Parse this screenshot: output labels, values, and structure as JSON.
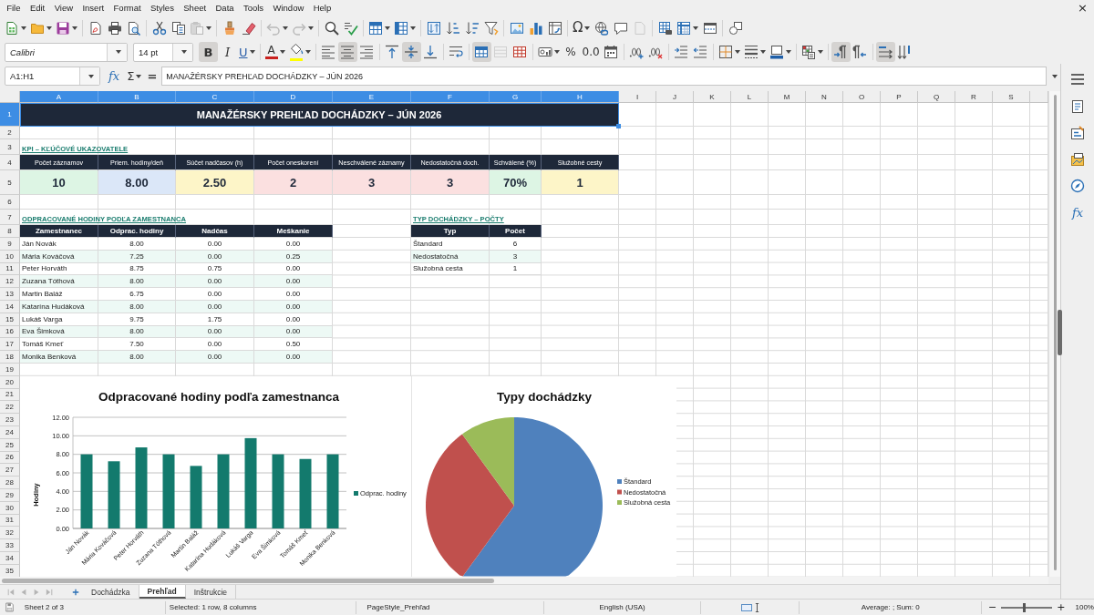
{
  "menu_bar": [
    "File",
    "Edit",
    "View",
    "Insert",
    "Format",
    "Styles",
    "Sheet",
    "Data",
    "Tools",
    "Window",
    "Help"
  ],
  "close_button": "×",
  "standard_toolbar": [
    [
      {
        "kind": "icon",
        "dropdown": true,
        "disabled": false
      },
      {
        "kind": "icon",
        "dropdown": true,
        "disabled": false
      },
      {
        "kind": "icon",
        "dropdown": true,
        "disabled": false
      }
    ],
    [
      {
        "kind": "icon",
        "dropdown": false,
        "disabled": false
      },
      {
        "kind": "icon",
        "dropdown": false,
        "disabled": false
      },
      {
        "kind": "icon",
        "dropdown": false,
        "disabled": false
      }
    ],
    [
      {
        "kind": "icon",
        "dropdown": false,
        "disabled": false
      },
      {
        "kind": "icon",
        "dropdown": false,
        "disabled": false
      },
      {
        "kind": "icon",
        "dropdown": true,
        "disabled": true
      }
    ],
    [
      {
        "kind": "icon",
        "dropdown": false,
        "disabled": false
      },
      {
        "kind": "icon",
        "dropdown": false,
        "disabled": false
      }
    ],
    [
      {
        "kind": "icon",
        "dropdown": true,
        "disabled": true
      },
      {
        "kind": "icon",
        "dropdown": true,
        "disabled": true
      }
    ],
    [
      {
        "kind": "icon",
        "dropdown": false,
        "disabled": false
      },
      {
        "kind": "icon",
        "dropdown": false,
        "disabled": false
      }
    ],
    [
      {
        "kind": "icon",
        "dropdown": true,
        "disabled": false
      },
      {
        "kind": "icon",
        "dropdown": true,
        "disabled": false
      }
    ],
    [
      {
        "kind": "icon",
        "dropdown": false,
        "disabled": false
      },
      {
        "kind": "icon",
        "dropdown": false,
        "disabled": false
      },
      {
        "kind": "icon",
        "dropdown": false,
        "disabled": false
      },
      {
        "kind": "icon",
        "dropdown": false,
        "disabled": false
      }
    ],
    [
      {
        "kind": "icon",
        "dropdown": false,
        "disabled": false
      },
      {
        "kind": "icon",
        "dropdown": false,
        "disabled": false
      },
      {
        "kind": "icon",
        "dropdown": false,
        "disabled": false
      }
    ],
    [
      {
        "kind": "glyph",
        "label": "Ω",
        "dropdown": true,
        "disabled": false
      },
      {
        "kind": "icon",
        "dropdown": false,
        "disabled": false
      },
      {
        "kind": "icon",
        "dropdown": false,
        "disabled": false
      },
      {
        "kind": "icon",
        "dropdown": false,
        "disabled": true
      }
    ],
    [
      {
        "kind": "icon",
        "dropdown": false,
        "disabled": false
      },
      {
        "kind": "icon",
        "dropdown": true,
        "disabled": false
      },
      {
        "kind": "icon",
        "dropdown": false,
        "disabled": false
      }
    ],
    [
      {
        "kind": "icon",
        "dropdown": false,
        "disabled": false
      }
    ]
  ],
  "formatting_toolbar": {
    "font_name": "Calibri",
    "font_size": "14 pt",
    "groups": [
      [
        {
          "kind": "glyph",
          "label": "B",
          "dropdown": false,
          "on": true,
          "disabled": false
        },
        {
          "kind": "glyph",
          "label": "I",
          "dropdown": false,
          "on": false,
          "disabled": false
        },
        {
          "kind": "glyph",
          "label": "U",
          "dropdown": true,
          "on": false,
          "disabled": false
        }
      ],
      [
        {
          "kind": "glyph",
          "label": "A",
          "dropdown": true,
          "on": false,
          "disabled": false,
          "color": "#c9211e"
        },
        {
          "kind": "icon",
          "dropdown": true,
          "on": false,
          "disabled": false,
          "color": "#ffff00"
        }
      ],
      [
        {
          "kind": "icon",
          "dropdown": false,
          "on": false,
          "disabled": false
        },
        {
          "kind": "icon",
          "dropdown": false,
          "on": true,
          "disabled": false
        },
        {
          "kind": "icon",
          "dropdown": false,
          "on": false,
          "disabled": false
        }
      ],
      [
        {
          "kind": "icon",
          "dropdown": false,
          "on": false,
          "disabled": false
        },
        {
          "kind": "icon",
          "dropdown": false,
          "on": true,
          "disabled": false
        },
        {
          "kind": "icon",
          "dropdown": false,
          "on": false,
          "disabled": false
        }
      ],
      [
        {
          "kind": "icon",
          "dropdown": false,
          "on": false,
          "disabled": false
        }
      ],
      [
        {
          "kind": "icon",
          "dropdown": false,
          "on": true,
          "disabled": false
        },
        {
          "kind": "icon",
          "dropdown": false,
          "on": false,
          "disabled": true
        },
        {
          "kind": "icon",
          "dropdown": false,
          "on": false,
          "disabled": false
        }
      ],
      [
        {
          "kind": "icon",
          "dropdown": true,
          "on": false,
          "disabled": false
        },
        {
          "kind": "glyph",
          "label": "%",
          "dropdown": false,
          "on": false,
          "disabled": false
        },
        {
          "kind": "glyph",
          "label": "0.0",
          "dropdown": false,
          "on": false,
          "disabled": false
        },
        {
          "kind": "icon",
          "dropdown": false,
          "on": false,
          "disabled": false
        }
      ],
      [
        {
          "kind": "icon",
          "dropdown": false,
          "on": false,
          "disabled": false
        },
        {
          "kind": "icon",
          "dropdown": false,
          "on": false,
          "disabled": false
        }
      ],
      [
        {
          "kind": "icon",
          "dropdown": false,
          "on": false,
          "disabled": false
        },
        {
          "kind": "icon",
          "dropdown": false,
          "on": false,
          "disabled": false
        }
      ],
      [
        {
          "kind": "icon",
          "dropdown": true,
          "on": false,
          "disabled": false
        },
        {
          "kind": "icon",
          "dropdown": true,
          "on": false,
          "disabled": false
        },
        {
          "kind": "icon",
          "dropdown": true,
          "on": false,
          "disabled": false
        }
      ],
      [
        {
          "kind": "icon",
          "dropdown": true,
          "on": false,
          "disabled": false
        }
      ],
      [
        {
          "kind": "icon",
          "dropdown": false,
          "on": true,
          "disabled": false
        },
        {
          "kind": "icon",
          "dropdown": false,
          "on": false,
          "disabled": false
        }
      ],
      [
        {
          "kind": "icon",
          "dropdown": false,
          "on": true,
          "disabled": false
        },
        {
          "kind": "icon",
          "dropdown": false,
          "on": false,
          "disabled": false
        }
      ]
    ]
  },
  "formula_bar": {
    "name_box": "A1:H1",
    "function_wizard": "fx",
    "sum": "Σ",
    "formula": "=",
    "content": "MANAŽÉRSKY PREHĽAD DOCHÁDZKY – JÚN 2026"
  },
  "sidebar": {
    "decks": [
      {
        "kind": "icon",
        "selected": false
      },
      {
        "kind": "icon",
        "selected": false
      },
      {
        "kind": "icon",
        "selected": false
      },
      {
        "kind": "icon",
        "selected": false
      },
      {
        "kind": "glyph",
        "label": "fx",
        "selected": false
      }
    ]
  },
  "sheet": {
    "column_headers": [
      {
        "label": "A",
        "selected": true
      },
      {
        "label": "B",
        "selected": true
      },
      {
        "label": "C",
        "selected": true
      },
      {
        "label": "D",
        "selected": true
      },
      {
        "label": "E",
        "selected": true
      },
      {
        "label": "F",
        "selected": true
      },
      {
        "label": "G",
        "selected": true
      },
      {
        "label": "H",
        "selected": true
      },
      {
        "label": "I",
        "selected": false
      },
      {
        "label": "J",
        "selected": false
      },
      {
        "label": "K",
        "selected": false
      },
      {
        "label": "L",
        "selected": false
      },
      {
        "label": "M",
        "selected": false
      },
      {
        "label": "N",
        "selected": false
      },
      {
        "label": "O",
        "selected": false
      },
      {
        "label": "P",
        "selected": false
      },
      {
        "label": "Q",
        "selected": false
      },
      {
        "label": "R",
        "selected": false
      },
      {
        "label": "S",
        "selected": false
      }
    ],
    "row_headers": [
      {
        "label": "1",
        "selected": true
      },
      {
        "label": "2",
        "selected": false
      },
      {
        "label": "3",
        "selected": false
      },
      {
        "label": "4",
        "selected": false
      },
      {
        "label": "5",
        "selected": false
      },
      {
        "label": "6",
        "selected": false
      },
      {
        "label": "7",
        "selected": false
      },
      {
        "label": "8",
        "selected": false
      },
      {
        "label": "9",
        "selected": false
      },
      {
        "label": "10",
        "selected": false
      },
      {
        "label": "11",
        "selected": false
      },
      {
        "label": "12",
        "selected": false
      },
      {
        "label": "13",
        "selected": false
      },
      {
        "label": "14",
        "selected": false
      },
      {
        "label": "15",
        "selected": false
      },
      {
        "label": "16",
        "selected": false
      },
      {
        "label": "17",
        "selected": false
      },
      {
        "label": "18",
        "selected": false
      },
      {
        "label": "19",
        "selected": false
      },
      {
        "label": "20",
        "selected": false
      },
      {
        "label": "21",
        "selected": false
      },
      {
        "label": "22",
        "selected": false
      },
      {
        "label": "23",
        "selected": false
      },
      {
        "label": "24",
        "selected": false
      },
      {
        "label": "25",
        "selected": false
      },
      {
        "label": "26",
        "selected": false
      },
      {
        "label": "27",
        "selected": false
      },
      {
        "label": "28",
        "selected": false
      },
      {
        "label": "29",
        "selected": false
      },
      {
        "label": "30",
        "selected": false
      },
      {
        "label": "31",
        "selected": false
      },
      {
        "label": "32",
        "selected": false
      },
      {
        "label": "33",
        "selected": false
      },
      {
        "label": "34",
        "selected": false
      },
      {
        "label": "35",
        "selected": false
      }
    ],
    "title": {
      "text": "MANAŽÉRSKY PREHĽAD DOCHÁDZKY – JÚN 2026",
      "selected": true
    },
    "kpi": {
      "heading": "KPI – KĽÚČOVÉ UKAZOVATELE",
      "items": [
        {
          "label": "Počet záznamov",
          "value": "10",
          "color": "#ddf5e4"
        },
        {
          "label": "Priem. hodiny/deň",
          "value": "8.00",
          "color": "#dbe7f8"
        },
        {
          "label": "Súčet nadčasov (h)",
          "value": "2.50",
          "color": "#fdf5c8"
        },
        {
          "label": "Počet oneskorení",
          "value": "2",
          "color": "#fbe0e0"
        },
        {
          "label": "Neschválené záznamy",
          "value": "3",
          "color": "#fbe0e0"
        },
        {
          "label": "Nedostatočná doch.",
          "value": "3",
          "color": "#fbe0e0"
        },
        {
          "label": "Schválené (%)",
          "value": "70%",
          "color": "#ddf5e4"
        },
        {
          "label": "Služobné cesty",
          "value": "1",
          "color": "#fdf5c8"
        }
      ]
    },
    "hours_table": {
      "heading": "ODPRACOVANÉ HODINY PODĽA ZAMESTNANCA",
      "columns": [
        "Zamestnanec",
        "Odprac. hodiny",
        "Nadčas",
        "Meškanie"
      ],
      "rows": [
        [
          "Ján Novák",
          "8.00",
          "0.00",
          "0.00"
        ],
        [
          "Mária Kováčová",
          "7.25",
          "0.00",
          "0.25"
        ],
        [
          "Peter Horváth",
          "8.75",
          "0.75",
          "0.00"
        ],
        [
          "Zuzana Tóthová",
          "8.00",
          "0.00",
          "0.00"
        ],
        [
          "Martin Baláž",
          "6.75",
          "0.00",
          "0.00"
        ],
        [
          "Katarína Hudáková",
          "8.00",
          "0.00",
          "0.00"
        ],
        [
          "Lukáš Varga",
          "9.75",
          "1.75",
          "0.00"
        ],
        [
          "Eva Šimková",
          "8.00",
          "0.00",
          "0.00"
        ],
        [
          "Tomáš Kmeť",
          "7.50",
          "0.00",
          "0.50"
        ],
        [
          "Monika Benková",
          "8.00",
          "0.00",
          "0.00"
        ]
      ]
    },
    "types_table": {
      "heading": "TYP DOCHÁDZKY – POČTY",
      "columns": [
        "Typ",
        "Počet"
      ],
      "rows": [
        [
          "Štandard",
          "6"
        ],
        [
          "Nedostatočná",
          "3"
        ],
        [
          "Služobná cesta",
          "1"
        ]
      ]
    },
    "bar_chart": {
      "chart_data": {
        "type": "bar",
        "title": "Odpracované hodiny podľa zamestnanca",
        "ylabel": "Hodiny",
        "categories": [
          "Ján Novák",
          "Mária Kováčová",
          "Peter Horváth",
          "Zuzana Tóthová",
          "Martin Baláž",
          "Katarína Hudáková",
          "Lukáš Varga",
          "Eva Šimková",
          "Tomáš Kmeť",
          "Monika Benková"
        ],
        "series": [
          {
            "name": "Odprac. hodiny",
            "color": "#137a6d",
            "values": [
              8,
              7.25,
              8.75,
              8,
              6.75,
              8,
              9.75,
              8,
              7.5,
              8
            ]
          }
        ],
        "ylim": [
          0,
          12
        ],
        "yticks": [
          {
            "value": 0,
            "label": "0.00"
          },
          {
            "value": 2,
            "label": "2.00"
          },
          {
            "value": 4,
            "label": "4.00"
          },
          {
            "value": 6,
            "label": "6.00"
          },
          {
            "value": 8,
            "label": "8.00"
          },
          {
            "value": 10,
            "label": "10.00"
          },
          {
            "value": 12,
            "label": "12.00"
          }
        ],
        "grid": true,
        "legend": "right"
      }
    },
    "pie_chart": {
      "chart_data": {
        "type": "pie",
        "title": "Typy dochádzky",
        "categories": [
          "Štandard",
          "Nedostatočná",
          "Služobná cesta"
        ],
        "values": [
          60,
          30,
          10
        ],
        "colors": [
          "#4f81bd",
          "#c0504d",
          "#9bbb59"
        ],
        "legend": "right"
      }
    }
  },
  "sheet_navigation": [
    {
      "disabled": true
    },
    {
      "disabled": true
    },
    {
      "disabled": true
    },
    {
      "disabled": true
    }
  ],
  "sheet_tabs": [
    {
      "label": "Dochádzka",
      "selected": false
    },
    {
      "label": "Prehľad",
      "selected": true
    },
    {
      "label": "Inštrukcie",
      "selected": false
    }
  ],
  "status_bar": {
    "sheet": "Sheet 2 of 3",
    "selection": "Selected: 1 row, 8 columns",
    "page_style": "PageStyle_Prehľad",
    "language": "English (USA)",
    "summary": "Average: ; Sum: 0",
    "zoom": {
      "minus": "−",
      "plus": "+",
      "level": 0.45,
      "value": "100%"
    }
  }
}
